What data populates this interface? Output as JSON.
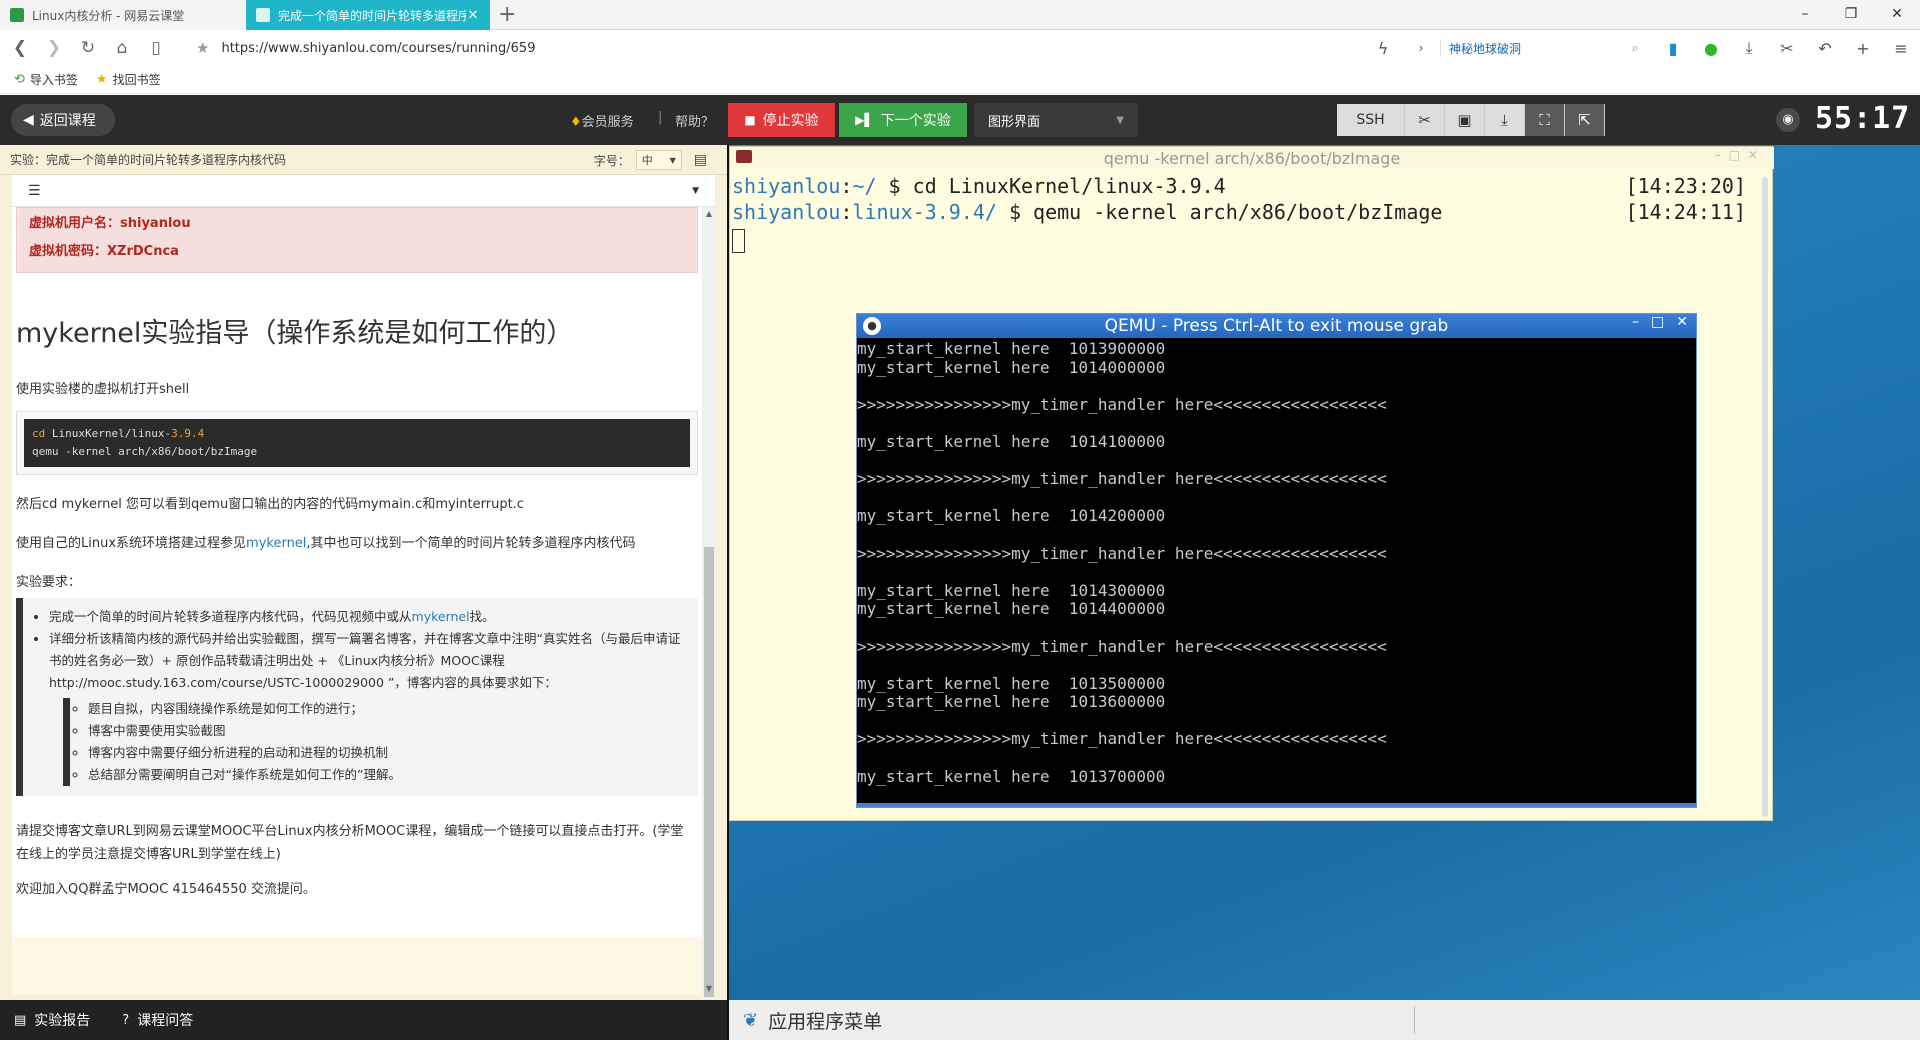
{
  "browser": {
    "tabs": [
      {
        "title": "Linux内核分析 - 网易云课堂",
        "active": false
      },
      {
        "title": "完成一个简单的时间片轮转多道程序",
        "active": true
      }
    ],
    "new_tab": "+",
    "url": "https://www.shiyanlou.com/courses/running/659",
    "search_text": "神秘地球破洞",
    "bookmarks": [
      {
        "label": "导入书签",
        "icon": "import-icon"
      },
      {
        "label": "找回书签",
        "icon": "star-icon"
      }
    ],
    "window_controls": [
      "–",
      "❐",
      "✕"
    ]
  },
  "toolbar": {
    "back_label": "返回课程",
    "member_label": "会员服务",
    "separator": "|",
    "help_label": "帮助？",
    "stop_label": "停止实验",
    "next_label": "下一个实验",
    "mode_label": "图形界面",
    "ssh_label": "SSH",
    "timer": "55:17",
    "colors": {
      "stop": "#e0383a",
      "next": "#3ca54a",
      "bar": "#2b2b2b"
    }
  },
  "left": {
    "header_title": "实验：完成一个简单的时间片轮转多道程序内核代码",
    "font_size_label": "字号：",
    "font_size_value": "中",
    "vm_user": "虚拟机用户名：shiyanlou",
    "vm_pass": "虚拟机密码：XZrDCnca",
    "heading": "mykernel实验指导（操作系统是如何工作的）",
    "p1": "使用实验楼的虚拟机打开shell",
    "code_line1_cmd": "cd",
    "code_line1_path_a": " LinuxKernel/linux-",
    "code_line1_ver": "3.9.4",
    "code_line2": "qemu -kernel arch/x86/boot/bzImage",
    "p2": "然后cd mykernel 您可以看到qemu窗口输出的内容的代码mymain.c和myinterrupt.c",
    "p3_a": "使用自己的Linux系统环境搭建过程参见",
    "p3_link": "mykernel",
    "p3_b": ",其中也可以找到一个简单的时间片轮转多道程序内核代码",
    "req_title": "实验要求：",
    "li1_a": "完成一个简单的时间片轮转多道程序内核代码，代码见视频中或从",
    "li1_link": "mykernel",
    "li1_b": "找。",
    "li2": "详细分析该精简内核的源代码并给出实验截图，撰写一篇署名博客，并在博客文章中注明“真实姓名（与最后申请证书的姓名务必一致）+ 原创作品转载请注明出处 + 《Linux内核分析》MOOC课程http://mooc.study.163.com/course/USTC-1000029000 ”，博客内容的具体要求如下：",
    "sub_items": [
      "题目自拟，内容围绕操作系统是如何工作的进行；",
      "博客中需要使用实验截图",
      "博客内容中需要仔细分析进程的启动和进程的切换机制",
      "总结部分需要阐明自己对“操作系统是如何工作的”理解。"
    ],
    "p4": "请提交博客文章URL到网易云课堂MOOC平台Linux内核分析MOOC课程，编辑成一个链接可以直接点击打开。(学堂在线上的学员注意提交博客URL到学堂在线上)",
    "p5": "欢迎加入QQ群孟宁MOOC 415464550 交流提问。",
    "footer": {
      "report": "实验报告",
      "qa": "课程问答"
    }
  },
  "vm": {
    "terminal_title": "qemu -kernel arch/x86/boot/bzImage",
    "terminal_lines": [
      {
        "user": "shiyanlou",
        "sep": ":",
        "dir": "~/",
        "cmd": " $ cd LinuxKernel/linux-3.9.4",
        "time": "[14:23:20]"
      },
      {
        "user": "shiyanlou",
        "sep": ":",
        "dir": "linux-3.9.4/",
        "cmd": " $ qemu -kernel arch/x86/boot/bzImage",
        "time": "[14:24:11]"
      }
    ],
    "qemu_title": "QEMU - Press Ctrl-Alt to exit mouse grab",
    "qemu_lines": [
      "my_start_kernel here  1013900000",
      "my_start_kernel here  1014000000",
      "",
      ">>>>>>>>>>>>>>>>my_timer_handler here<<<<<<<<<<<<<<<<<<",
      "",
      "my_start_kernel here  1014100000",
      "",
      ">>>>>>>>>>>>>>>>my_timer_handler here<<<<<<<<<<<<<<<<<<",
      "",
      "my_start_kernel here  1014200000",
      "",
      ">>>>>>>>>>>>>>>>my_timer_handler here<<<<<<<<<<<<<<<<<<",
      "",
      "my_start_kernel here  1014300000",
      "my_start_kernel here  1014400000",
      "",
      ">>>>>>>>>>>>>>>>my_timer_handler here<<<<<<<<<<<<<<<<<<",
      "",
      "my_start_kernel here  1013500000",
      "my_start_kernel here  1013600000",
      "",
      ">>>>>>>>>>>>>>>>my_timer_handler here<<<<<<<<<<<<<<<<<<",
      "",
      "my_start_kernel here  1013700000"
    ],
    "taskbar_label": "应用程序菜单"
  }
}
